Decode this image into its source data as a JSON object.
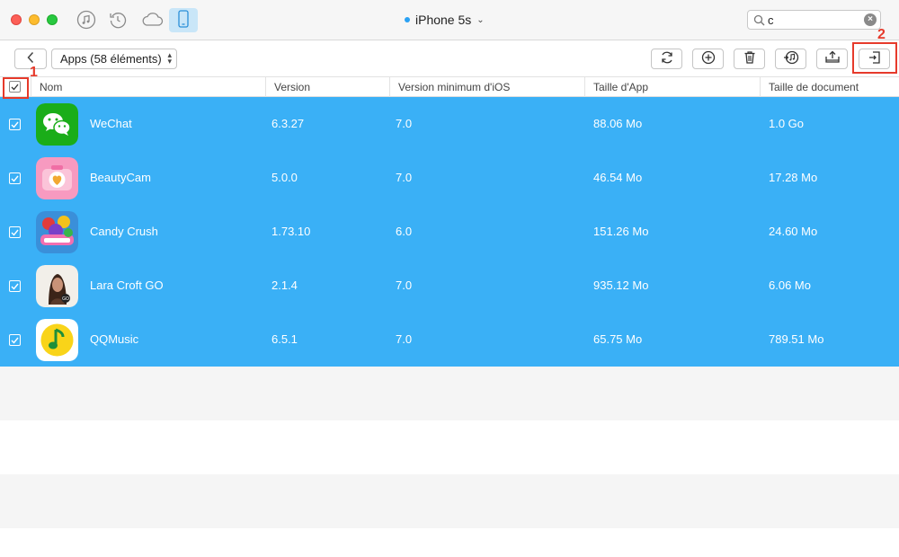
{
  "device": {
    "name": "iPhone 5s",
    "dropdown_icon": "chevron-down-icon"
  },
  "search": {
    "value": "c"
  },
  "toolbar": {
    "category_select": "Apps (58 éléments)",
    "buttons": [
      "refresh-icon",
      "add-icon",
      "delete-icon",
      "itunes-transfer-icon",
      "export-to-computer-icon",
      "export-to-device-icon"
    ]
  },
  "table": {
    "headers": {
      "name": "Nom",
      "version": "Version",
      "min_version": "Version minimum d'iOS",
      "app_size": "Taille d'App",
      "doc_size": "Taille de document"
    },
    "rows": [
      {
        "name": "WeChat",
        "version": "6.3.27",
        "min_version": "7.0",
        "app_size": "88.06 Mo",
        "doc_size": "1.0 Go",
        "icon": "wechat-app-icon"
      },
      {
        "name": "BeautyCam",
        "version": "5.0.0",
        "min_version": "7.0",
        "app_size": "46.54 Mo",
        "doc_size": "17.28 Mo",
        "icon": "beautycam-app-icon"
      },
      {
        "name": "Candy Crush",
        "version": "1.73.10",
        "min_version": "6.0",
        "app_size": "151.26 Mo",
        "doc_size": "24.60 Mo",
        "icon": "candy-crush-app-icon"
      },
      {
        "name": "Lara Croft GO",
        "version": "2.1.4",
        "min_version": "7.0",
        "app_size": "935.12 Mo",
        "doc_size": "6.06 Mo",
        "icon": "lara-croft-go-app-icon"
      },
      {
        "name": "QQMusic",
        "version": "6.5.1",
        "min_version": "7.0",
        "app_size": "65.75 Mo",
        "doc_size": "789.51 Mo",
        "icon": "qqmusic-app-icon"
      }
    ]
  },
  "annotations": {
    "step1": "1",
    "step2": "2"
  },
  "colors": {
    "selection": "#3ab0f6",
    "annotation": "#e63a2b",
    "device_active": "#c9e6f8"
  }
}
